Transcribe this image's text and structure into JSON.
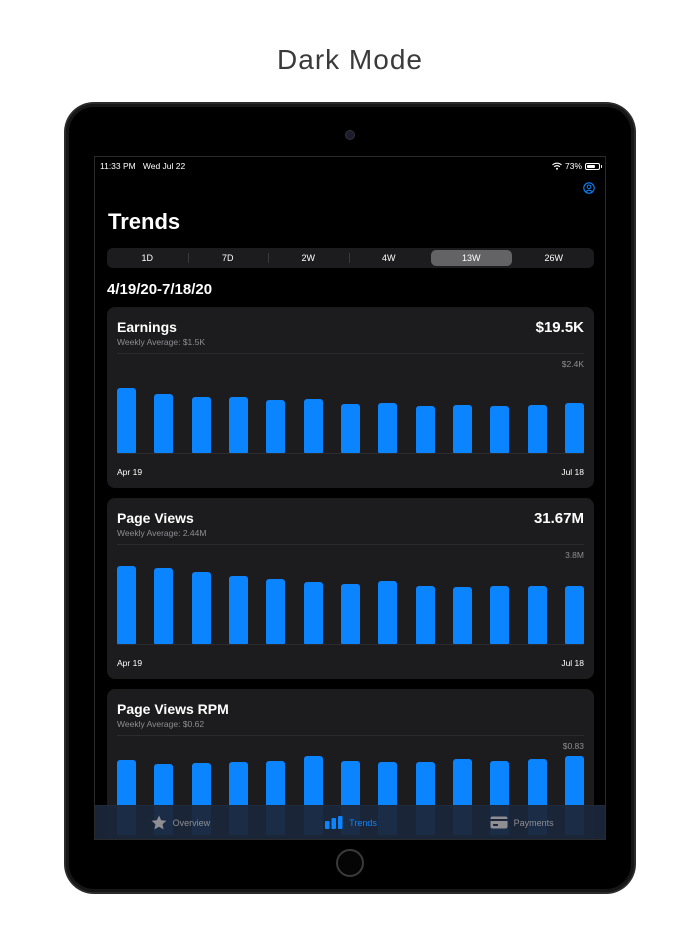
{
  "caption": "Dark Mode",
  "status": {
    "time": "11:33 PM",
    "date": "Wed Jul 22",
    "battery": "73%",
    "battery_level": 0.73
  },
  "nav": {
    "title": "Trends"
  },
  "periods": [
    {
      "label": "1D",
      "active": false
    },
    {
      "label": "7D",
      "active": false
    },
    {
      "label": "2W",
      "active": false
    },
    {
      "label": "4W",
      "active": false
    },
    {
      "label": "13W",
      "active": true
    },
    {
      "label": "26W",
      "active": false
    }
  ],
  "date_range": "4/19/20-7/18/20",
  "cards": [
    {
      "title": "Earnings",
      "total": "$19.5K",
      "subtitle": "Weekly Average: $1.5K",
      "max_label": "$2.4K",
      "x_start": "Apr 19",
      "x_end": "Jul 18"
    },
    {
      "title": "Page Views",
      "total": "31.67M",
      "subtitle": "Weekly Average: 2.44M",
      "max_label": "3.8M",
      "x_start": "Apr 19",
      "x_end": "Jul 18"
    },
    {
      "title": "Page Views RPM",
      "total": "",
      "subtitle": "Weekly Average: $0.62",
      "max_label": "$0.83",
      "x_start": "",
      "x_end": ""
    }
  ],
  "chart_data": [
    {
      "type": "bar",
      "title": "Earnings",
      "ylabel": "",
      "ylim": [
        0,
        2400
      ],
      "values": [
        1950,
        1780,
        1680,
        1680,
        1580,
        1630,
        1480,
        1510,
        1400,
        1450,
        1410,
        1450,
        1500
      ],
      "categories": [
        "Apr 19",
        "",
        "",
        "",
        "",
        "",
        "",
        "",
        "",
        "",
        "",
        "",
        "Jul 18"
      ],
      "bar_color": "#0a84ff"
    },
    {
      "type": "bar",
      "title": "Page Views",
      "ylabel": "",
      "ylim": [
        0,
        3800
      ],
      "values": [
        3700,
        3620,
        3420,
        3250,
        3100,
        2960,
        2860,
        2980,
        2760,
        2730,
        2740,
        2760,
        2740
      ],
      "categories": [
        "Apr 19",
        "",
        "",
        "",
        "",
        "",
        "",
        "",
        "",
        "",
        "",
        "",
        "Jul 18"
      ],
      "bar_color": "#0a84ff"
    },
    {
      "type": "bar",
      "title": "Page Views RPM",
      "ylabel": "",
      "ylim": [
        0,
        0.83
      ],
      "values": [
        0.78,
        0.74,
        0.75,
        0.76,
        0.77,
        0.82,
        0.77,
        0.76,
        0.76,
        0.79,
        0.77,
        0.79,
        0.82
      ],
      "categories": [
        "",
        "",
        "",
        "",
        "",
        "",
        "",
        "",
        "",
        "",
        "",
        "",
        ""
      ],
      "bar_color": "#0a84ff"
    }
  ],
  "tabs": [
    {
      "label": "Overview",
      "icon": "star-icon",
      "active": false
    },
    {
      "label": "Trends",
      "icon": "bar-chart-icon",
      "active": true
    },
    {
      "label": "Payments",
      "icon": "credit-card-icon",
      "active": false
    }
  ],
  "colors": {
    "accent": "#0a84ff",
    "card_bg": "#1c1c1e",
    "secondary_text": "#8e8e93"
  }
}
